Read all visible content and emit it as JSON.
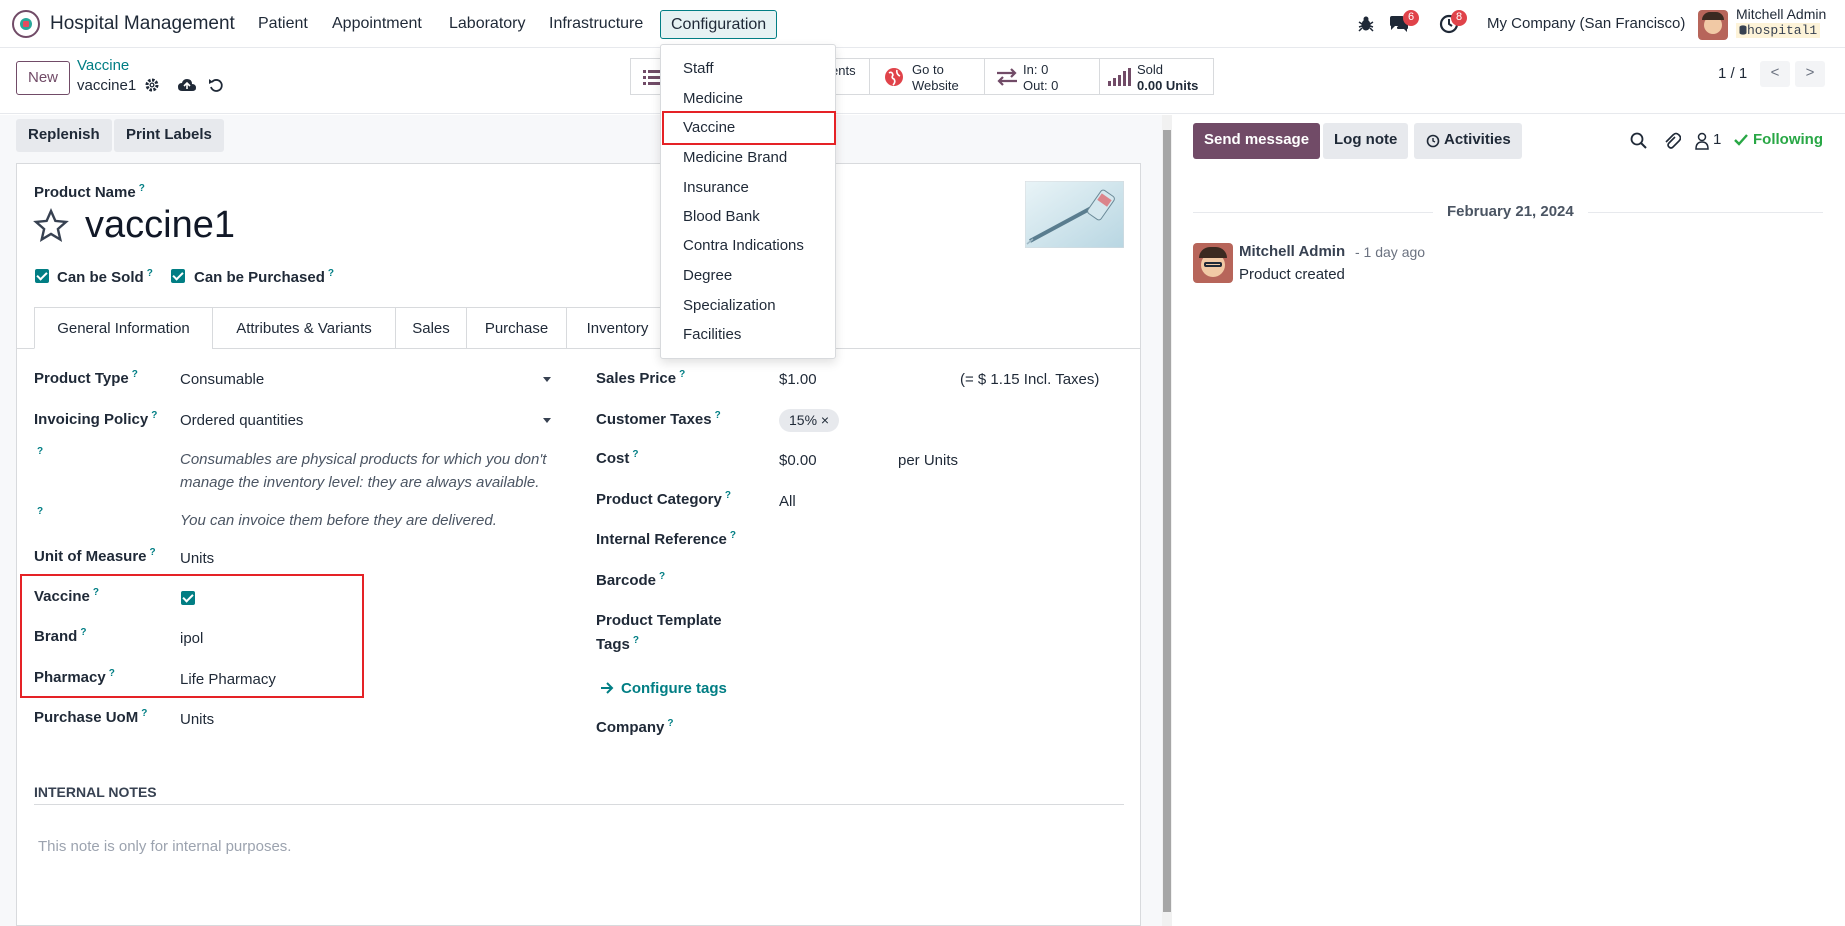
{
  "navbar": {
    "app_name": "Hospital Management",
    "menu": [
      "Patient",
      "Appointment",
      "Laboratory",
      "Infrastructure"
    ],
    "active_menu": "Configuration",
    "messages_badge": "6",
    "activities_badge": "8",
    "company": "My Company (San Francisco)",
    "user_name": "Mitchell Admin",
    "db_name": "hospital1"
  },
  "control": {
    "new_label": "New",
    "breadcrumb_parent": "Vaccine",
    "breadcrumb_current": "vaccine1",
    "smart_documents_tail": "ents",
    "smart_website_line1": "Go to",
    "smart_website_line2": "Website",
    "smart_in": "In: 0",
    "smart_out": "Out: 0",
    "smart_sold_label": "Sold",
    "smart_sold_value": "0.00 Units",
    "pager": "1 / 1",
    "pager_prev": "<",
    "pager_next": ">"
  },
  "dropdown": {
    "items": [
      "Staff",
      "Medicine",
      "Vaccine",
      "Medicine Brand",
      "Insurance",
      "Blood Bank",
      "Contra Indications",
      "Degree",
      "Specialization",
      "Facilities"
    ]
  },
  "actions": {
    "replenish": "Replenish",
    "print_labels": "Print Labels"
  },
  "product": {
    "name_label": "Product Name",
    "name": "vaccine1",
    "can_be_sold": "Can be Sold",
    "can_be_purchased": "Can be Purchased"
  },
  "tabs": [
    "General Information",
    "Attributes & Variants",
    "Sales",
    "Purchase",
    "Inventory"
  ],
  "left_fields": {
    "product_type_label": "Product Type",
    "product_type": "Consumable",
    "invoicing_label": "Invoicing Policy",
    "invoicing": "Ordered quantities",
    "hint1_line1": "Consumables are physical products for which you don't",
    "hint1_line2": "manage the inventory level: they are always available.",
    "hint2": "You can invoice them before they are delivered.",
    "uom_label": "Unit of Measure",
    "uom": "Units",
    "vaccine_label": "Vaccine",
    "brand_label": "Brand",
    "brand": "ipol",
    "pharmacy_label": "Pharmacy",
    "pharmacy": "Life Pharmacy",
    "purchase_uom_label": "Purchase UoM",
    "purchase_uom": "Units"
  },
  "right_fields": {
    "sales_price_label": "Sales Price",
    "sales_price": "$1.00",
    "incl_taxes": "(= $ 1.15 Incl. Taxes)",
    "customer_taxes_label": "Customer Taxes",
    "tax_tag": "15% ×",
    "cost_label": "Cost",
    "cost": "$0.00",
    "per_units": "per Units",
    "category_label": "Product Category",
    "category": "All",
    "internal_ref_label": "Internal Reference",
    "barcode_label": "Barcode",
    "template_tags_line1": "Product Template",
    "template_tags_line2": "Tags",
    "configure_tags": "Configure tags",
    "company_label": "Company"
  },
  "notes": {
    "title": "INTERNAL NOTES",
    "placeholder": "This note is only for internal purposes."
  },
  "chatter": {
    "send_message": "Send message",
    "log_note": "Log note",
    "activities": "Activities",
    "followers_count": "1",
    "following": "Following",
    "date": "February 21, 2024",
    "author": "Mitchell Admin",
    "time": "- 1 day ago",
    "message": "Product created"
  },
  "colors": {
    "brand": "#714b67",
    "accent": "#017e84",
    "highlight_box": "#e52226",
    "badge": "#e0434a"
  }
}
